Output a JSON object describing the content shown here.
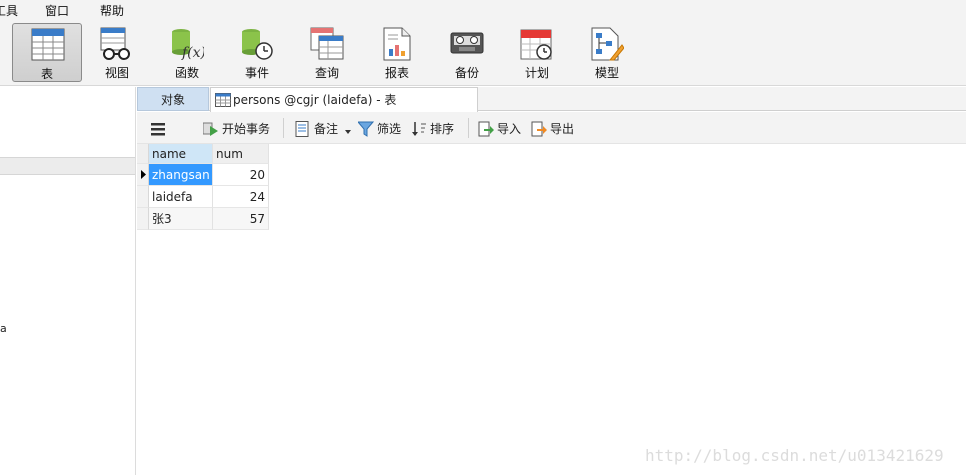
{
  "menu": {
    "items": [
      "工具",
      "窗口",
      "帮助"
    ]
  },
  "ribbon": {
    "buttons": [
      {
        "label": "表",
        "icon": "table-icon",
        "active": true
      },
      {
        "label": "视图",
        "icon": "view-glasses-icon"
      },
      {
        "label": "函数",
        "icon": "function-icon"
      },
      {
        "label": "事件",
        "icon": "event-clock-icon"
      },
      {
        "label": "查询",
        "icon": "query-icon"
      },
      {
        "label": "报表",
        "icon": "report-icon"
      },
      {
        "label": "备份",
        "icon": "backup-icon"
      },
      {
        "label": "计划",
        "icon": "schedule-calendar-icon"
      },
      {
        "label": "模型",
        "icon": "model-icon"
      }
    ]
  },
  "left_pane": {
    "fragment": "a"
  },
  "tabs": {
    "objects": "对象",
    "table_tab": "persons @cgjr (laidefa) - 表"
  },
  "toolbar": {
    "begin_transaction": "开始事务",
    "memo": "备注",
    "filter": "筛选",
    "sort": "排序",
    "import": "导入",
    "export": "导出"
  },
  "grid": {
    "columns": [
      "name",
      "num"
    ],
    "rows": [
      {
        "name": "zhangsan",
        "num": "20"
      },
      {
        "name": "laidefa",
        "num": "24"
      },
      {
        "name": "张3",
        "num": "57"
      }
    ]
  },
  "watermark": "http://blog.csdn.net/u013421629",
  "colors": {
    "selection": "#3399ff",
    "tab_active": "#cfe0f2",
    "header_highlight": "#cfe6f7"
  }
}
